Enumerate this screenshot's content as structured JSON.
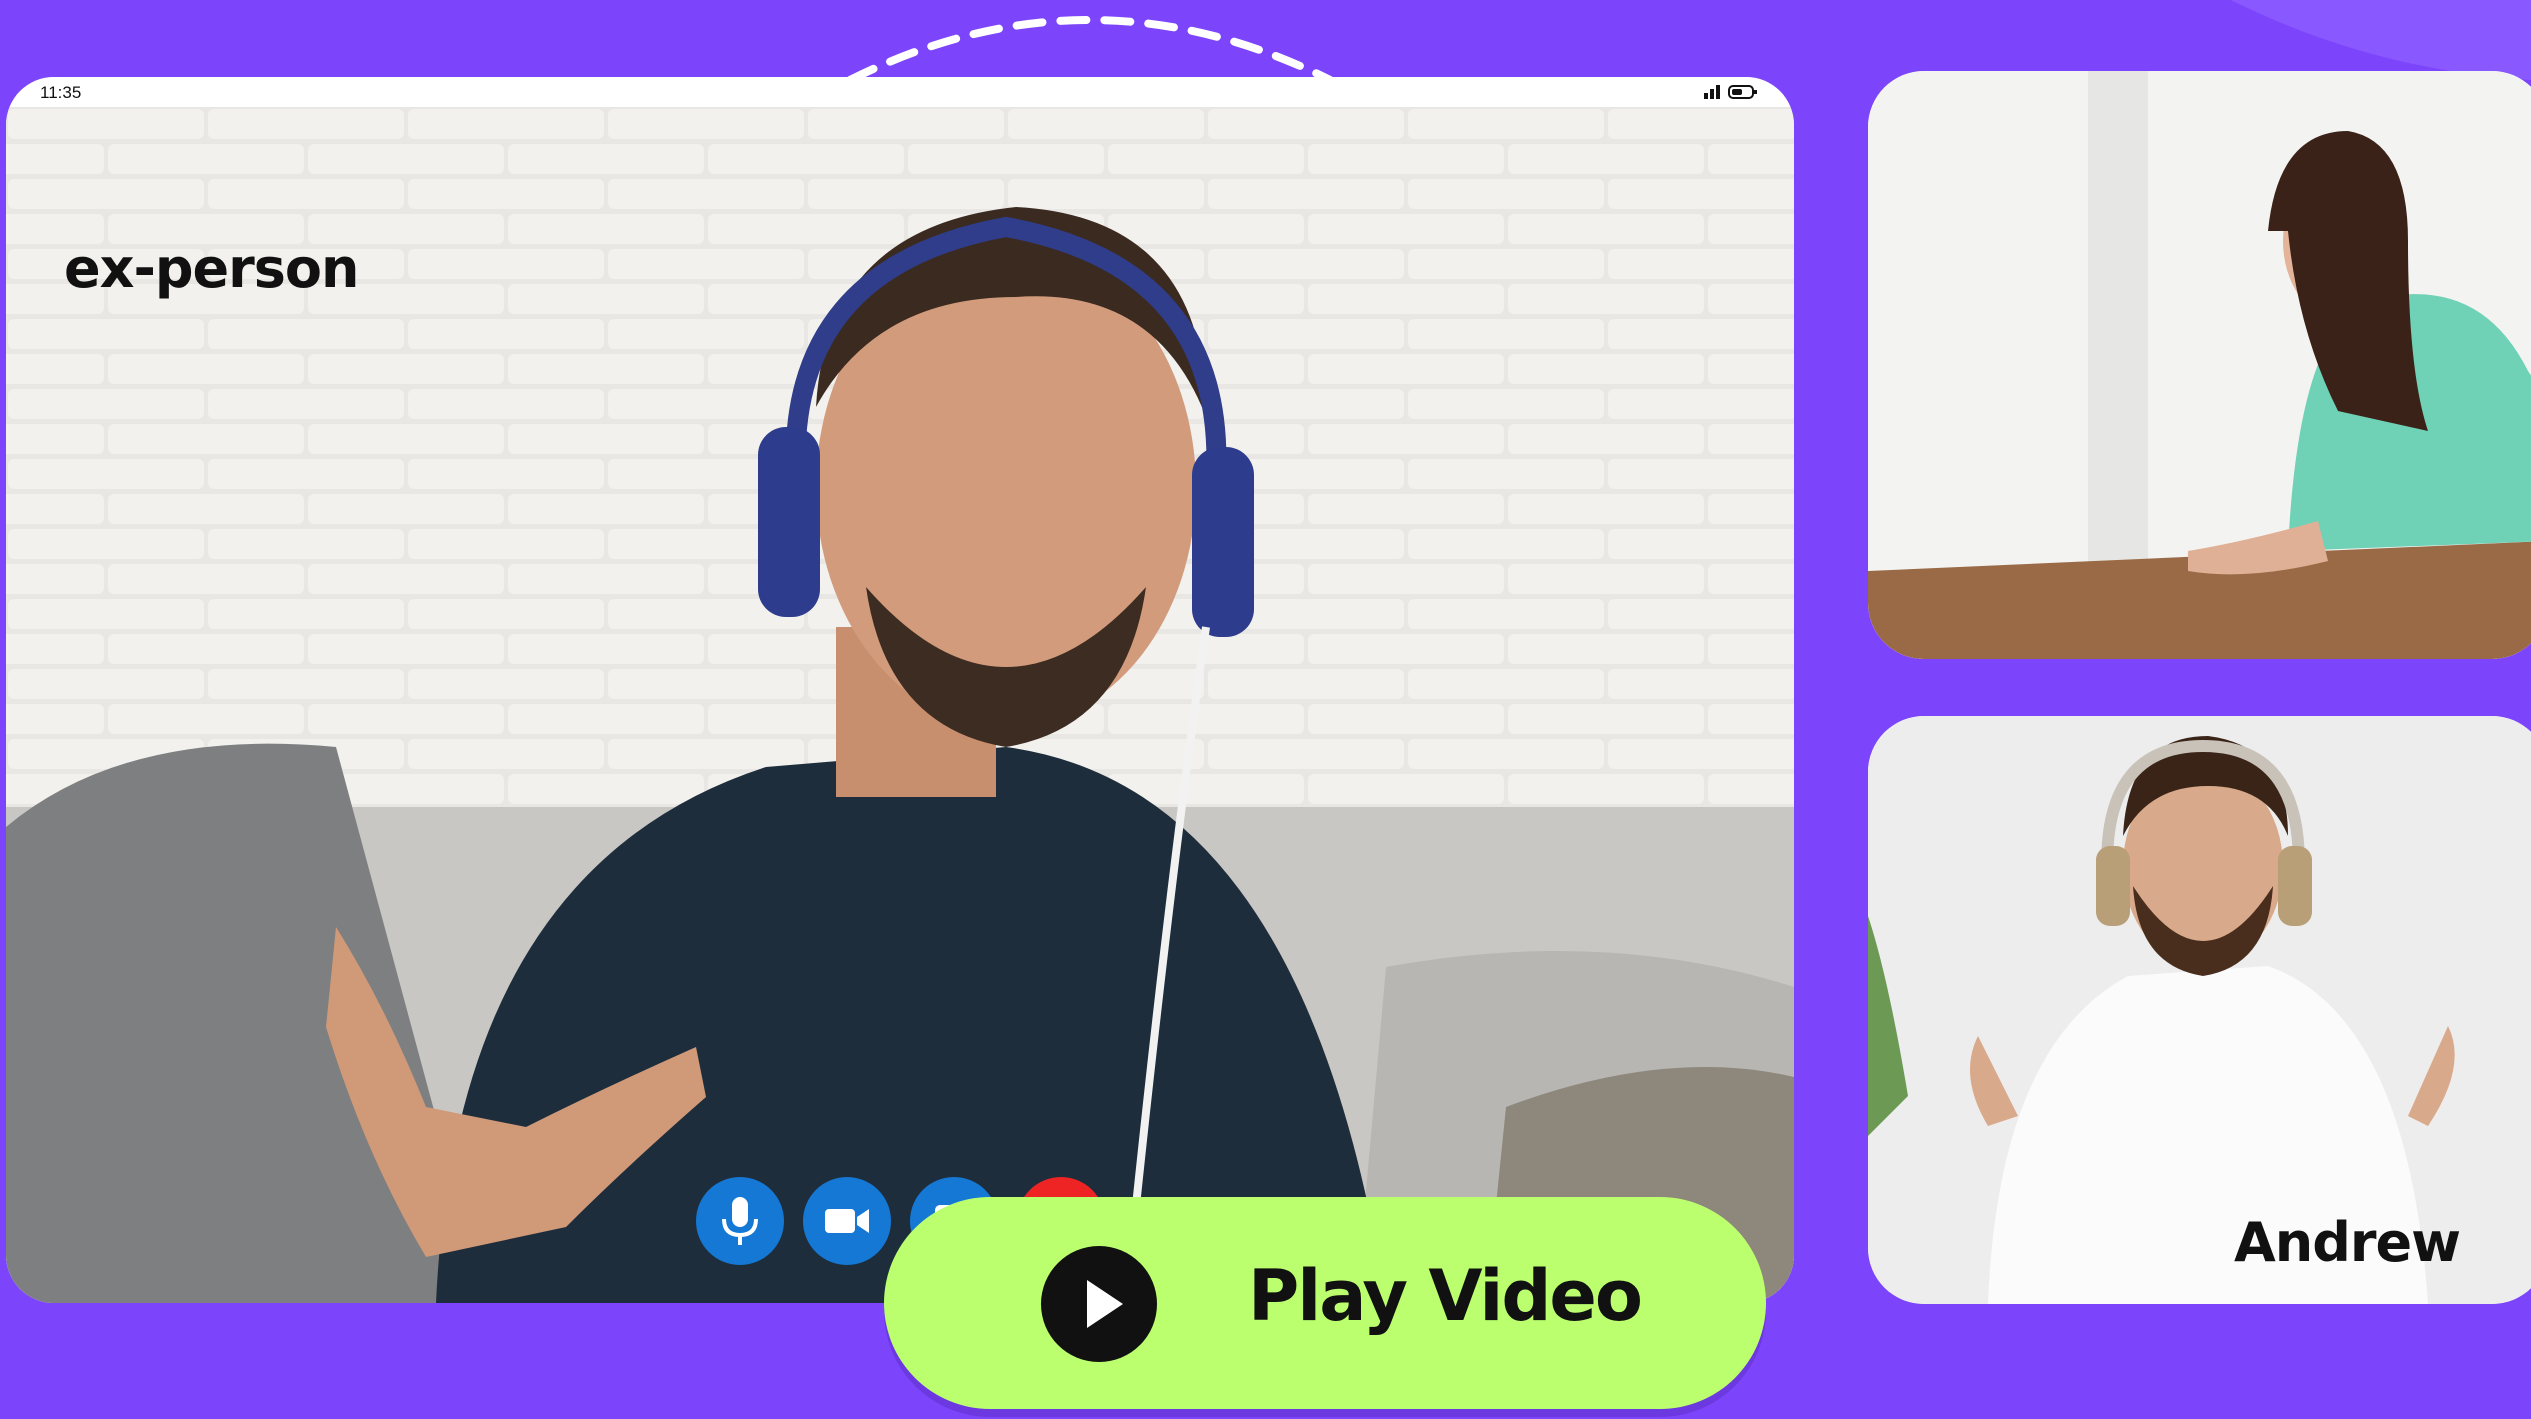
{
  "status_bar": {
    "time": "11:35"
  },
  "main_call": {
    "caller_name": "ex-person"
  },
  "participants": [
    {
      "name": ""
    },
    {
      "name": "Andrew"
    }
  ],
  "call_controls": [
    "microphone-icon",
    "video-camera-icon",
    "chat-icon",
    "end-call-icon"
  ],
  "play_button": {
    "label": "Play Video"
  },
  "colors": {
    "background": "#7c45fb",
    "play_button": "#bcff6e",
    "control_blue": "#1478d4",
    "end_call_red": "#ee2424"
  }
}
